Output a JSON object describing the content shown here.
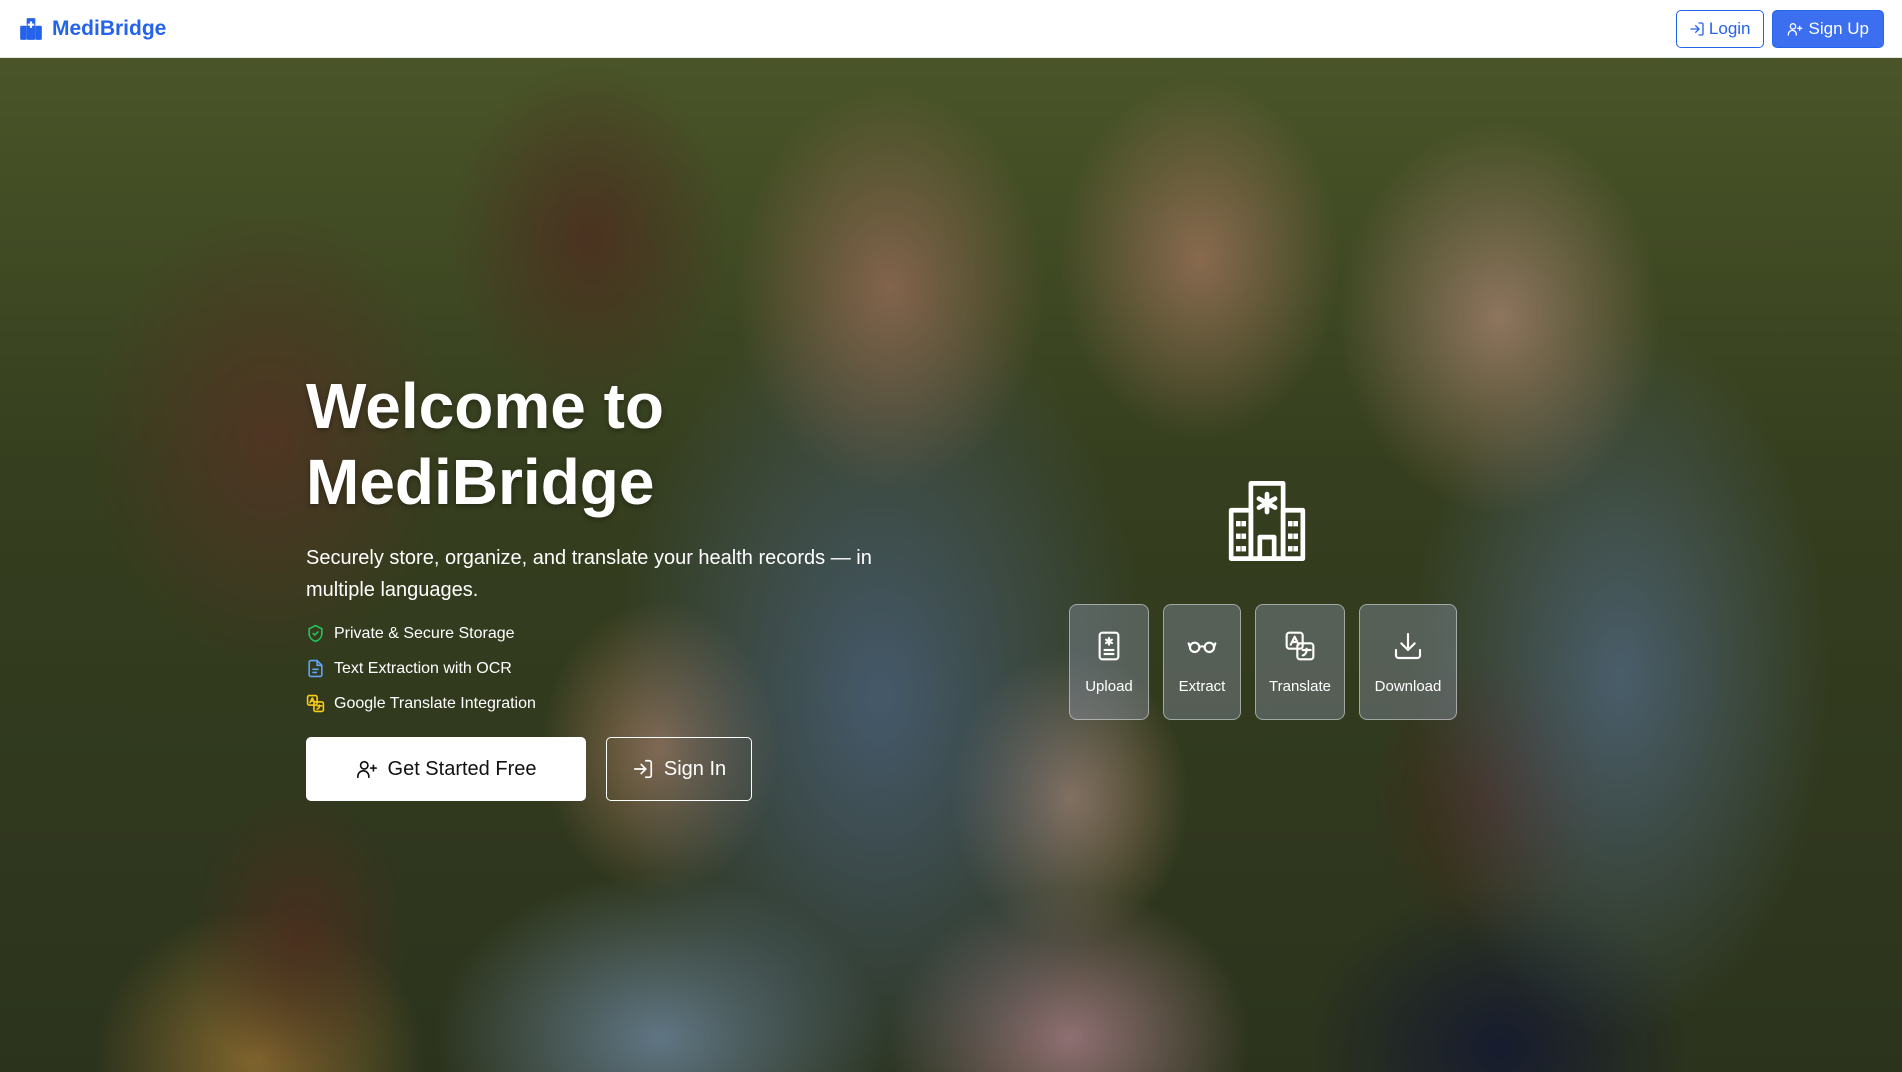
{
  "navbar": {
    "brand": "MediBridge",
    "login_label": "Login",
    "signup_label": "Sign Up"
  },
  "hero": {
    "title_line1": "Welcome to",
    "title_line2": "MediBridge",
    "subtitle": "Securely store, organize, and translate your health records — in multiple languages.",
    "features": [
      {
        "icon": "shield-icon",
        "label": "Private & Secure Storage",
        "color": "#22c55e"
      },
      {
        "icon": "document-icon",
        "label": "Text Extraction with OCR",
        "color": "#60a5fa"
      },
      {
        "icon": "translate-icon",
        "label": "Google Translate Integration",
        "color": "#facc15"
      }
    ],
    "cta_primary": "Get Started Free",
    "cta_secondary": "Sign In"
  },
  "steps": [
    {
      "icon": "upload-file-icon",
      "label": "Upload"
    },
    {
      "icon": "glasses-icon",
      "label": "Extract"
    },
    {
      "icon": "translate-icon",
      "label": "Translate"
    },
    {
      "icon": "download-icon",
      "label": "Download"
    }
  ],
  "colors": {
    "brand": "#2563eb",
    "signup_bg": "#3b6ff0"
  }
}
